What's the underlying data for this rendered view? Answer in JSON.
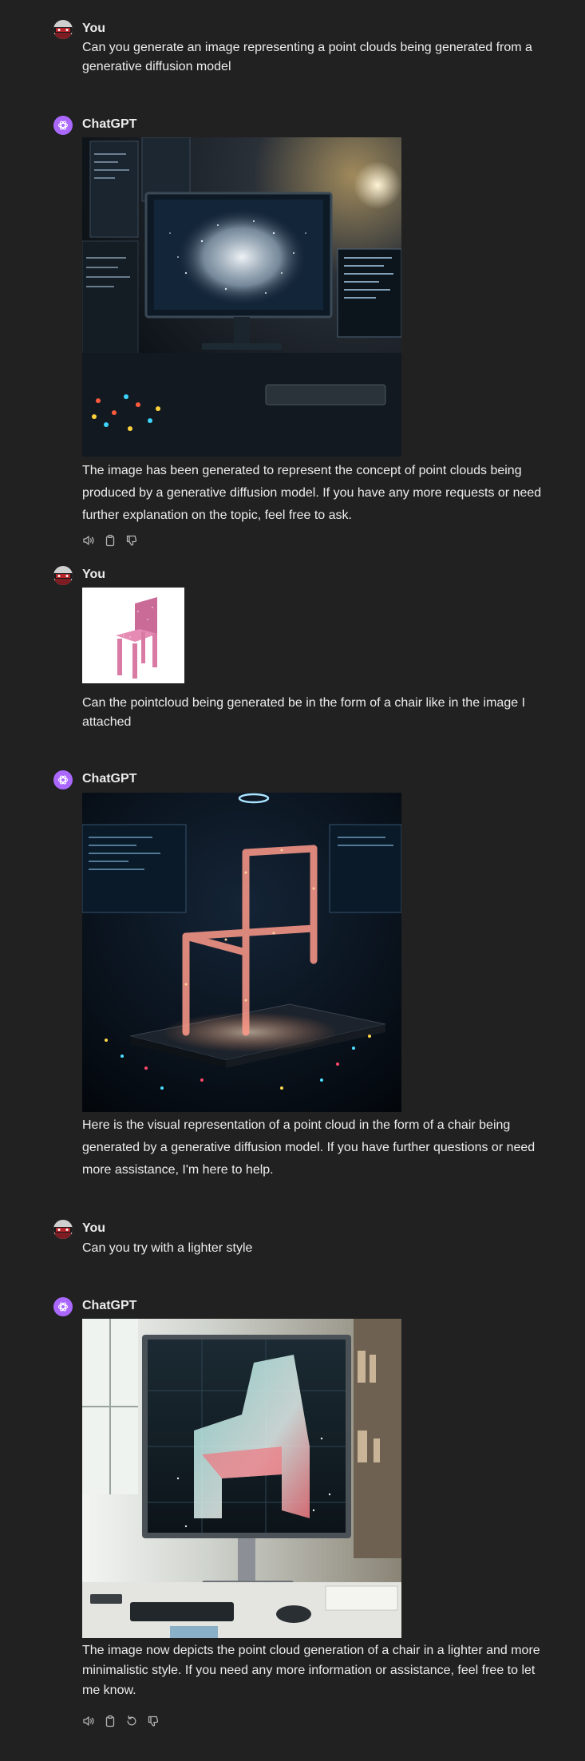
{
  "conversation": {
    "messages": [
      {
        "role": "user",
        "author": "You",
        "text": "Can you generate an image representing a point clouds being generated from a generative diffusion model"
      },
      {
        "role": "assistant",
        "author": "ChatGPT",
        "text": "The image has been generated to represent the concept of point clouds being produced by a generative diffusion model. If you have any more requests or need further explanation on the topic, feel free to ask."
      },
      {
        "role": "user",
        "author": "You",
        "text": "Can the pointcloud being generated be in the form of a chair like in the image I attached"
      },
      {
        "role": "assistant",
        "author": "ChatGPT",
        "text": "Here is the visual representation of a point cloud in the form of a chair being generated by a generative diffusion model. If you have further questions or need more assistance, I'm here to help."
      },
      {
        "role": "user",
        "author": "You",
        "text": "Can you try with a lighter style"
      },
      {
        "role": "assistant",
        "author": "ChatGPT",
        "text": "The image now depicts the point cloud generation of a chair in a lighter and more minimalistic style. If you need any more information or assistance, feel free to let me know."
      }
    ],
    "icons": {
      "read_aloud": "speaker-icon",
      "copy": "clipboard-icon",
      "regenerate": "regenerate-icon",
      "dislike": "thumbs-down-icon"
    },
    "colors": {
      "background": "#212121",
      "text": "#ececec",
      "gpt_avatar": "#ab68ff",
      "icon": "#b4b4b4"
    }
  }
}
